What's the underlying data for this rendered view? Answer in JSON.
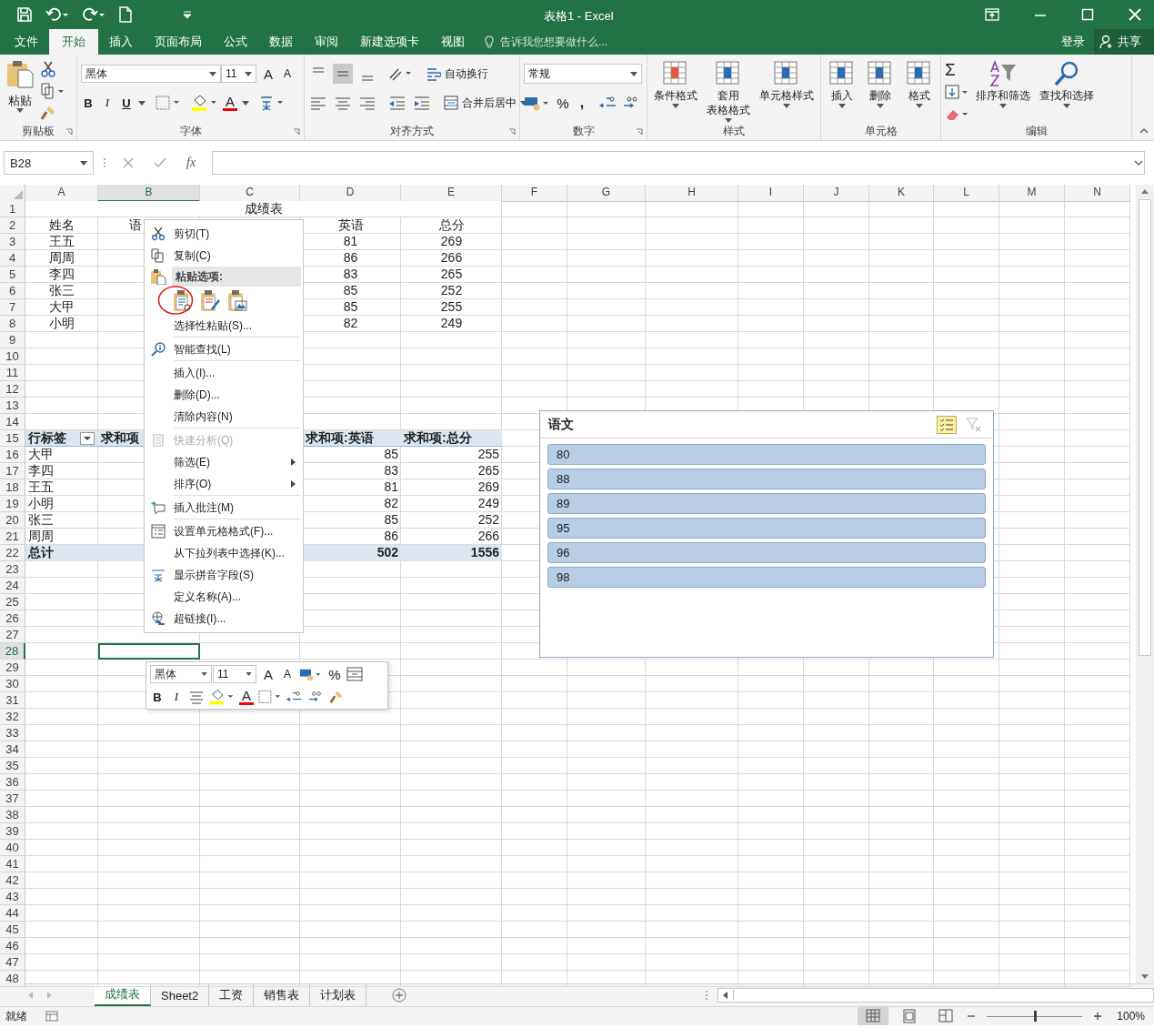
{
  "window": {
    "title": "表格1 - Excel"
  },
  "ribbon_tabs": [
    {
      "label": "文件",
      "selected": false
    },
    {
      "label": "开始",
      "selected": true
    },
    {
      "label": "插入",
      "selected": false
    },
    {
      "label": "页面布局",
      "selected": false
    },
    {
      "label": "公式",
      "selected": false
    },
    {
      "label": "数据",
      "selected": false
    },
    {
      "label": "审阅",
      "selected": false
    },
    {
      "label": "新建选项卡",
      "selected": false
    },
    {
      "label": "视图",
      "selected": false
    }
  ],
  "tell_me": {
    "placeholder": "告诉我您想要做什么..."
  },
  "account": {
    "sign_in": "登录",
    "share": "共享"
  },
  "ribbon_groups": [
    {
      "label": "剪贴板",
      "buttons": [
        {
          "lines": [
            "粘贴"
          ]
        }
      ]
    },
    {
      "label": "字体",
      "font": "黑体",
      "size": "11",
      "grow": "A",
      "shrink": "A",
      "bold": "B",
      "italic": "I",
      "underline": "U",
      "font_color": "A"
    },
    {
      "label": "对齐方式",
      "vertical_align": [
        {
          "selected": false
        },
        {
          "selected": true
        },
        {
          "selected": false
        }
      ],
      "wrap": "自动换行",
      "merge": "合并后居中"
    },
    {
      "label": "数字",
      "format": "常规",
      "percent": "%",
      "comma": ","
    },
    {
      "label": "样式",
      "buttons": [
        {
          "lines": [
            "条件格式"
          ]
        },
        {
          "lines": [
            "套用",
            "表格格式"
          ]
        },
        {
          "lines": [
            "单元格样式"
          ]
        }
      ]
    },
    {
      "label": "单元格",
      "buttons": [
        {
          "lines": [
            "插入"
          ]
        },
        {
          "lines": [
            "删除"
          ]
        },
        {
          "lines": [
            "格式"
          ]
        }
      ]
    },
    {
      "label": "编辑",
      "sum": "Σ",
      "buttons": [
        {
          "lines": [
            "排序和筛选"
          ]
        },
        {
          "lines": [
            "查找和选择"
          ]
        }
      ]
    }
  ],
  "formula_bar": {
    "name_box": "B28",
    "fx": "fx"
  },
  "columns": [
    {
      "label": "A",
      "selected": false
    },
    {
      "label": "B",
      "selected": true
    },
    {
      "label": "C",
      "selected": false
    },
    {
      "label": "D",
      "selected": false
    },
    {
      "label": "E",
      "selected": false
    },
    {
      "label": "F",
      "selected": false
    },
    {
      "label": "G",
      "selected": false
    },
    {
      "label": "H",
      "selected": false
    },
    {
      "label": "I",
      "selected": false
    },
    {
      "label": "J",
      "selected": false
    },
    {
      "label": "K",
      "selected": false
    },
    {
      "label": "L",
      "selected": false
    },
    {
      "label": "M",
      "selected": false
    },
    {
      "label": "N",
      "selected": false
    }
  ],
  "rows": [
    {
      "number": "1",
      "kind": "title",
      "selected": false,
      "cells": {
        "C": "成绩表"
      }
    },
    {
      "number": "2",
      "kind": "header",
      "selected": false,
      "cells": {
        "A": "姓名",
        "B": "语",
        "D": "英语",
        "E": "总分"
      }
    },
    {
      "number": "3",
      "kind": "data",
      "selected": false,
      "cells": {
        "A": "王五",
        "D": "81",
        "E": "269"
      }
    },
    {
      "number": "4",
      "kind": "data",
      "selected": false,
      "cells": {
        "A": "周周",
        "D": "86",
        "E": "266"
      }
    },
    {
      "number": "5",
      "kind": "data",
      "selected": false,
      "cells": {
        "A": "李四",
        "D": "83",
        "E": "265"
      }
    },
    {
      "number": "6",
      "kind": "data",
      "selected": false,
      "cells": {
        "A": "张三",
        "D": "85",
        "E": "252"
      }
    },
    {
      "number": "7",
      "kind": "data",
      "selected": false,
      "cells": {
        "A": "大甲",
        "D": "85",
        "E": "255"
      }
    },
    {
      "number": "8",
      "kind": "data",
      "selected": false,
      "cells": {
        "A": "小明",
        "D": "82",
        "E": "249"
      }
    },
    {
      "number": "9",
      "kind": "empty",
      "selected": false
    },
    {
      "number": "10",
      "kind": "empty",
      "selected": false
    },
    {
      "number": "11",
      "kind": "empty",
      "selected": false
    },
    {
      "number": "12",
      "kind": "empty",
      "selected": false
    },
    {
      "number": "13",
      "kind": "empty",
      "selected": false
    },
    {
      "number": "14",
      "kind": "empty",
      "selected": false
    },
    {
      "number": "15",
      "kind": "pivot_header",
      "selected": false,
      "cells": {
        "A": "行标签",
        "B": "求和项",
        "D": "求和项:英语",
        "E": "求和项:总分"
      }
    },
    {
      "number": "16",
      "kind": "pivot_row",
      "selected": false,
      "cells": {
        "A": "大甲",
        "D": "85",
        "E": "255"
      }
    },
    {
      "number": "17",
      "kind": "pivot_row",
      "selected": false,
      "cells": {
        "A": "李四",
        "D": "83",
        "E": "265"
      }
    },
    {
      "number": "18",
      "kind": "pivot_row",
      "selected": false,
      "cells": {
        "A": "王五",
        "D": "81",
        "E": "269"
      }
    },
    {
      "number": "19",
      "kind": "pivot_row",
      "selected": false,
      "cells": {
        "A": "小明",
        "D": "82",
        "E": "249"
      }
    },
    {
      "number": "20",
      "kind": "pivot_row",
      "selected": false,
      "cells": {
        "A": "张三",
        "D": "85",
        "E": "252"
      }
    },
    {
      "number": "21",
      "kind": "pivot_row",
      "selected": false,
      "cells": {
        "A": "周周",
        "D": "86",
        "E": "266"
      }
    },
    {
      "number": "22",
      "kind": "pivot_total",
      "selected": false,
      "cells": {
        "A": "总计",
        "D": "502",
        "E": "1556"
      }
    },
    {
      "number": "23",
      "kind": "empty",
      "selected": false
    },
    {
      "number": "24",
      "kind": "empty",
      "selected": false
    },
    {
      "number": "25",
      "kind": "empty",
      "selected": false
    },
    {
      "number": "26",
      "kind": "empty",
      "selected": false
    },
    {
      "number": "27",
      "kind": "empty",
      "selected": false
    },
    {
      "number": "28",
      "kind": "empty",
      "selected": true
    },
    {
      "number": "29",
      "kind": "empty",
      "selected": false
    },
    {
      "number": "30",
      "kind": "empty",
      "selected": false
    },
    {
      "number": "31",
      "kind": "empty",
      "selected": false
    },
    {
      "number": "32",
      "kind": "empty",
      "selected": false
    },
    {
      "number": "33",
      "kind": "empty",
      "selected": false
    },
    {
      "number": "34",
      "kind": "empty",
      "selected": false
    },
    {
      "number": "35",
      "kind": "empty",
      "selected": false
    },
    {
      "number": "36",
      "kind": "empty",
      "selected": false
    },
    {
      "number": "37",
      "kind": "empty",
      "selected": false
    },
    {
      "number": "38",
      "kind": "empty",
      "selected": false
    },
    {
      "number": "39",
      "kind": "empty",
      "selected": false
    },
    {
      "number": "40",
      "kind": "empty",
      "selected": false
    },
    {
      "number": "41",
      "kind": "empty",
      "selected": false
    },
    {
      "number": "42",
      "kind": "empty",
      "selected": false
    },
    {
      "number": "43",
      "kind": "empty",
      "selected": false
    },
    {
      "number": "44",
      "kind": "empty",
      "selected": false
    },
    {
      "number": "45",
      "kind": "empty",
      "selected": false
    },
    {
      "number": "46",
      "kind": "empty",
      "selected": false
    },
    {
      "number": "47",
      "kind": "empty",
      "selected": false
    },
    {
      "number": "48",
      "kind": "empty",
      "selected": false
    }
  ],
  "context_menu": [
    {
      "kind": "item",
      "label": "剪切(T)",
      "disabled": false,
      "submenu": false
    },
    {
      "kind": "item",
      "label": "复制(C)",
      "disabled": false,
      "submenu": false
    },
    {
      "kind": "paste_header",
      "label": "粘贴选项:"
    },
    {
      "kind": "paste_options",
      "options": [
        {
          "circled": true
        },
        {
          "circled": false
        },
        {
          "circled": false
        }
      ]
    },
    {
      "kind": "item",
      "label": "选择性粘贴(S)...",
      "disabled": false,
      "submenu": false
    },
    {
      "kind": "separator"
    },
    {
      "kind": "item",
      "label": "智能查找(L)",
      "disabled": false,
      "submenu": false
    },
    {
      "kind": "separator"
    },
    {
      "kind": "item",
      "label": "插入(I)...",
      "disabled": false,
      "submenu": false
    },
    {
      "kind": "item",
      "label": "删除(D)...",
      "disabled": false,
      "submenu": false
    },
    {
      "kind": "item",
      "label": "清除内容(N)",
      "disabled": false,
      "submenu": false
    },
    {
      "kind": "separator"
    },
    {
      "kind": "item",
      "label": "快速分析(Q)",
      "disabled": true,
      "submenu": false
    },
    {
      "kind": "item",
      "label": "筛选(E)",
      "disabled": false,
      "submenu": true
    },
    {
      "kind": "item",
      "label": "排序(O)",
      "disabled": false,
      "submenu": true
    },
    {
      "kind": "separator"
    },
    {
      "kind": "item",
      "label": "插入批注(M)",
      "disabled": false,
      "submenu": false
    },
    {
      "kind": "separator"
    },
    {
      "kind": "item",
      "label": "设置单元格格式(F)...",
      "disabled": false,
      "submenu": false
    },
    {
      "kind": "item",
      "label": "从下拉列表中选择(K)...",
      "disabled": false,
      "submenu": false
    },
    {
      "kind": "item",
      "label": "显示拼音字段(S)",
      "disabled": false,
      "submenu": false
    },
    {
      "kind": "item",
      "label": "定义名称(A)...",
      "disabled": false,
      "submenu": false
    },
    {
      "kind": "item",
      "label": "超链接(I)...",
      "disabled": false,
      "submenu": false
    }
  ],
  "mini_toolbar": {
    "font": "黑体",
    "size": "11",
    "grow": "A",
    "shrink": "A",
    "percent": "%",
    "bold": "B",
    "italic": "I",
    "font_color": "A"
  },
  "slicer": {
    "title": "语文",
    "items": [
      {
        "label": "80",
        "selected": true
      },
      {
        "label": "88",
        "selected": true
      },
      {
        "label": "89",
        "selected": true
      },
      {
        "label": "95",
        "selected": true
      },
      {
        "label": "96",
        "selected": true
      },
      {
        "label": "98",
        "selected": true
      }
    ]
  },
  "sheet_tabs": [
    {
      "label": "成绩表",
      "selected": true
    },
    {
      "label": "Sheet2",
      "selected": false
    },
    {
      "label": "工资",
      "selected": false
    },
    {
      "label": "销售表",
      "selected": false
    },
    {
      "label": "计划表",
      "selected": false
    }
  ],
  "status_bar": {
    "status": "就绪",
    "zoom": "100%",
    "zoom_slider": {
      "level": 0.5
    }
  }
}
